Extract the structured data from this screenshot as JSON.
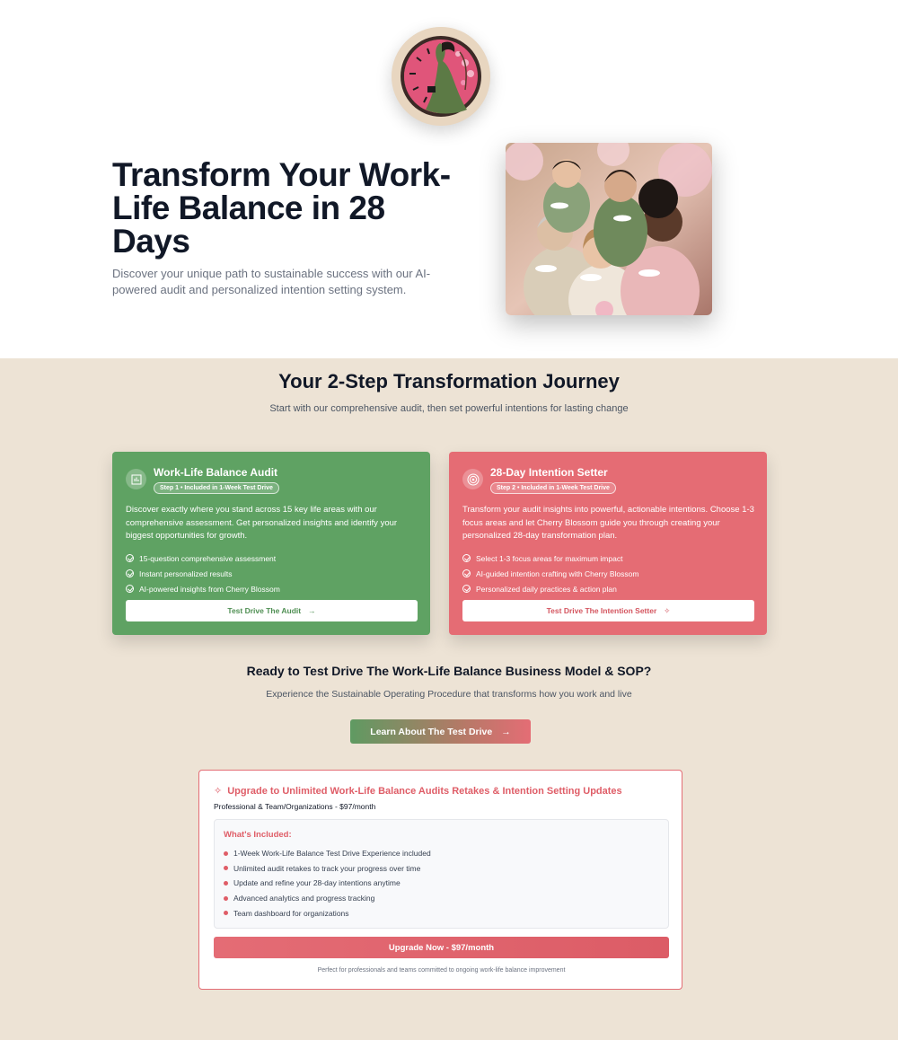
{
  "hero": {
    "title": "Transform Your Work-Life Balance in 28 Days",
    "subtitle": "Discover your unique path to sustainable success with our AI-powered audit and personalized intention setting system."
  },
  "journey": {
    "title": "Your 2-Step Transformation Journey",
    "subtitle": "Start with our comprehensive audit, then set powerful intentions for lasting change",
    "cards": [
      {
        "icon": "bar-chart-icon",
        "title": "Work-Life Balance Audit",
        "badge": "Step 1 • Included in 1-Week Test Drive",
        "description": "Discover exactly where you stand across 15 key life areas with our comprehensive assessment. Get personalized insights and identify your biggest opportunities for growth.",
        "features": [
          "15-question comprehensive assessment",
          "Instant personalized results",
          "AI-powered insights from Cherry Blossom"
        ],
        "button": "Test Drive The Audit",
        "button_icon": "arrow-right-icon",
        "color": "#5fa263"
      },
      {
        "icon": "target-icon",
        "title": "28-Day Intention Setter",
        "badge": "Step 2 • Included in 1-Week Test Drive",
        "description": "Transform your audit insights into powerful, actionable intentions. Choose 1-3 focus areas and let Cherry Blossom guide you through creating your personalized 28-day transformation plan.",
        "features": [
          "Select 1-3 focus areas for maximum impact",
          "AI-guided intention crafting with Cherry Blossom",
          "Personalized daily practices & action plan"
        ],
        "button": "Test Drive The Intention Setter",
        "button_icon": "sparkles-icon",
        "color": "#e56c74"
      }
    ]
  },
  "ready": {
    "title": "Ready to Test Drive The Work-Life Balance Business Model & SOP?",
    "subtitle": "Experience the Sustainable Operating Procedure that transforms how you work and live",
    "button": "Learn About The Test Drive"
  },
  "upgrade": {
    "title": "Upgrade to Unlimited Work-Life Balance Audits Retakes & Intention Setting Updates",
    "subtitle": "Professional & Team/Organizations - $97/month",
    "included_title": "What's Included:",
    "items": [
      "1-Week Work-Life Balance Test Drive Experience included",
      "Unlimited audit retakes to track your progress over time",
      "Update and refine your 28-day intentions anytime",
      "Advanced analytics and progress tracking",
      "Team dashboard for organizations"
    ],
    "button": "Upgrade Now - $97/month",
    "footnote": "Perfect for professionals and teams committed to ongoing work-life balance improvement",
    "accent": "#df5d67"
  }
}
